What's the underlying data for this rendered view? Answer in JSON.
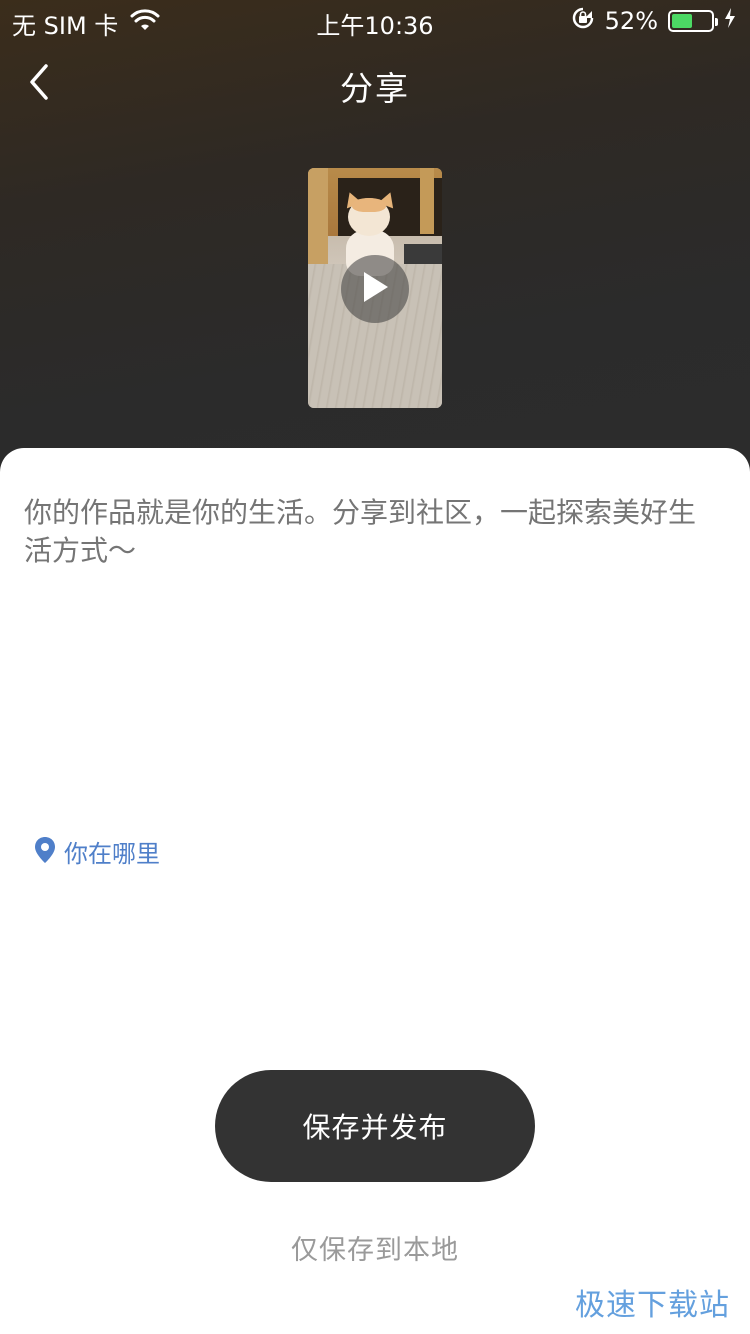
{
  "status_bar": {
    "carrier": "无 SIM 卡",
    "time": "上午10:36",
    "battery_percent_label": "52%",
    "battery_level": 0.52,
    "icons": [
      "wifi-icon",
      "rotation-lock-icon",
      "battery-icon",
      "charging-icon"
    ]
  },
  "nav": {
    "title": "分享",
    "back_icon": "chevron-left-icon"
  },
  "media": {
    "icon": "play-icon"
  },
  "compose": {
    "placeholder": "你的作品就是你的生活。分享到社区，一起探索美好生活方式～",
    "value": ""
  },
  "location": {
    "label": "你在哪里",
    "icon": "location-pin-icon",
    "color": "#4f7fc9"
  },
  "actions": {
    "publish_label": "保存并发布",
    "save_local_label": "仅保存到本地"
  },
  "watermark": "极速下载站",
  "colors": {
    "publish_bg": "#333333",
    "battery_fill": "#4cd964",
    "link": "#4f7fc9"
  }
}
